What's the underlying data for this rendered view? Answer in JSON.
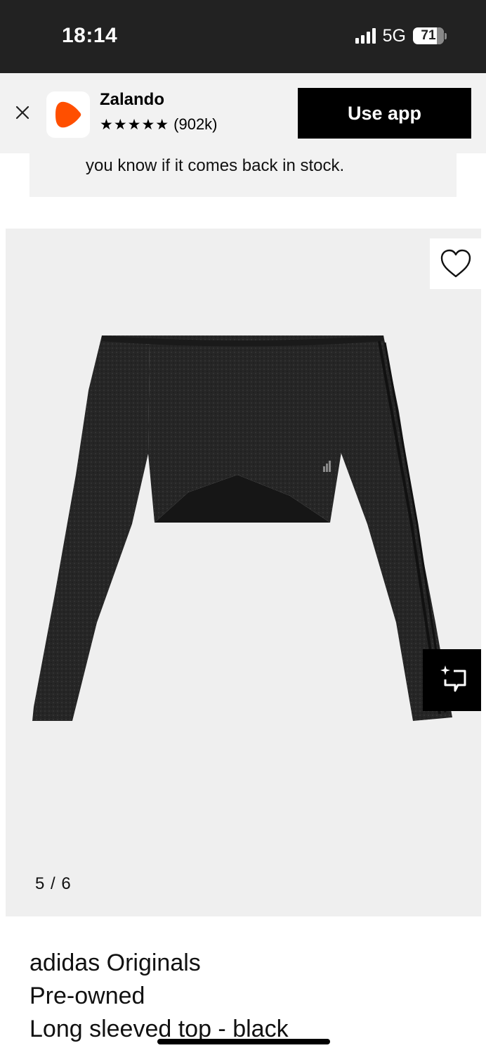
{
  "status_bar": {
    "time": "18:14",
    "network": "5G",
    "battery": "71"
  },
  "app_banner": {
    "app_name": "Zalando",
    "stars": "★★★★★",
    "rating_count": "(902k)",
    "cta": "Use app",
    "brand_color": "#ff4f00"
  },
  "notice": {
    "text": "you know if it comes back in stock."
  },
  "gallery": {
    "counter": "5 / 6",
    "current": 5,
    "total": 6,
    "background": "#efefef"
  },
  "product": {
    "brand": "adidas Originals",
    "condition": "Pre-owned",
    "name": "Long sleeved top - black"
  }
}
